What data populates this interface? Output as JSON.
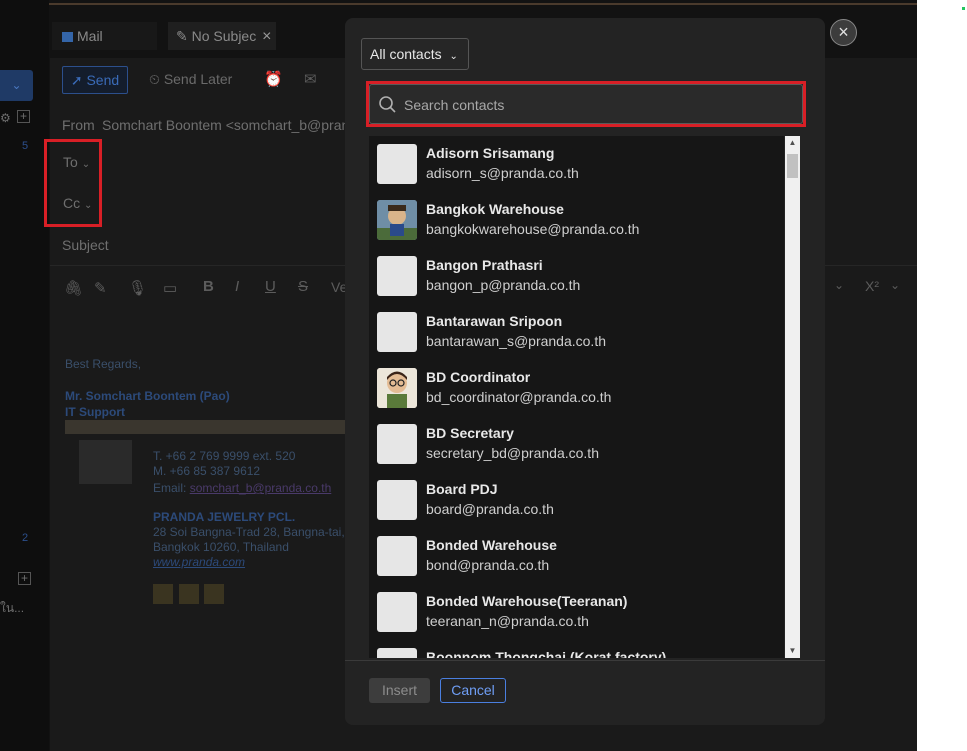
{
  "tabs": {
    "mail": "Mail",
    "draft": "No Subjec"
  },
  "toolbar": {
    "send": "Send",
    "send_later": "Send Later"
  },
  "compose": {
    "from_label": "From",
    "from_value": "Somchart Boontem <somchart_b@pran",
    "to_label": "To",
    "cc_label": "Cc",
    "subject_label": "Subject",
    "font_partial": "Ve"
  },
  "sidebar": {
    "count1": "5",
    "count2": "2",
    "trunc_text": "ใน..."
  },
  "signature": {
    "greeting": "Best Regards,",
    "name": "Mr. Somchart Boontem (Pao)",
    "dept": "IT Support",
    "tel": "T.  +66 2 769 9999 ext. 520",
    "mobile": "M.  +66 85 387 9612",
    "email_label": "Email: ",
    "email": "somchart_b@pranda.co.th",
    "company": "PRANDA JEWELRY PCL.",
    "addr1": "28 Soi Bangna-Trad 28, Bangna-tai,",
    "addr2": "Bangkok 10260, Thailand",
    "website": "www.pranda.com"
  },
  "dialog": {
    "filter": "All contacts",
    "search_placeholder": "Search contacts",
    "insert": "Insert",
    "cancel": "Cancel",
    "close": "×",
    "contacts": [
      {
        "name": "Adisorn Srisamang",
        "email": "adisorn_s@pranda.co.th",
        "avatar": "default"
      },
      {
        "name": "Bangkok Warehouse",
        "email": "bangkokwarehouse@pranda.co.th",
        "avatar": "photo-cartoon"
      },
      {
        "name": "Bangon Prathasri",
        "email": "bangon_p@pranda.co.th",
        "avatar": "default"
      },
      {
        "name": "Bantarawan Sripoon",
        "email": "bantarawan_s@pranda.co.th",
        "avatar": "default"
      },
      {
        "name": "BD Coordinator",
        "email": "bd_coordinator@pranda.co.th",
        "avatar": "photo-cartoon-boy"
      },
      {
        "name": "BD Secretary",
        "email": "secretary_bd@pranda.co.th",
        "avatar": "default"
      },
      {
        "name": "Board PDJ",
        "email": "board@pranda.co.th",
        "avatar": "default"
      },
      {
        "name": "Bonded Warehouse",
        "email": "bond@pranda.co.th",
        "avatar": "default"
      },
      {
        "name": "Bonded Warehouse(Teeranan)",
        "email": "teeranan_n@pranda.co.th",
        "avatar": "default"
      },
      {
        "name": "Boonnom Thongchai (Korat factory)",
        "email": "",
        "avatar": "default"
      }
    ]
  }
}
